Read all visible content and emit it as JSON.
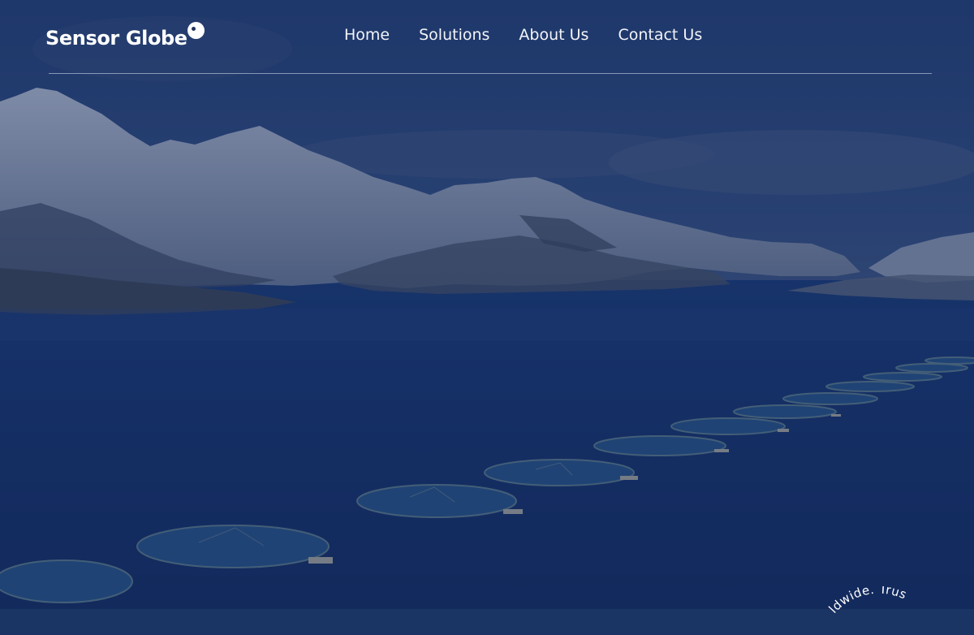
{
  "brand": {
    "name": "Sensor Globe"
  },
  "nav": {
    "items": [
      {
        "label": "Home"
      },
      {
        "label": "Solutions"
      },
      {
        "label": "About Us"
      },
      {
        "label": "Contact Us"
      }
    ]
  },
  "hero": {
    "badge_text": "ldwide. Trus"
  },
  "colors": {
    "overlay": "#1d3a6e",
    "text": "#ffffff"
  }
}
